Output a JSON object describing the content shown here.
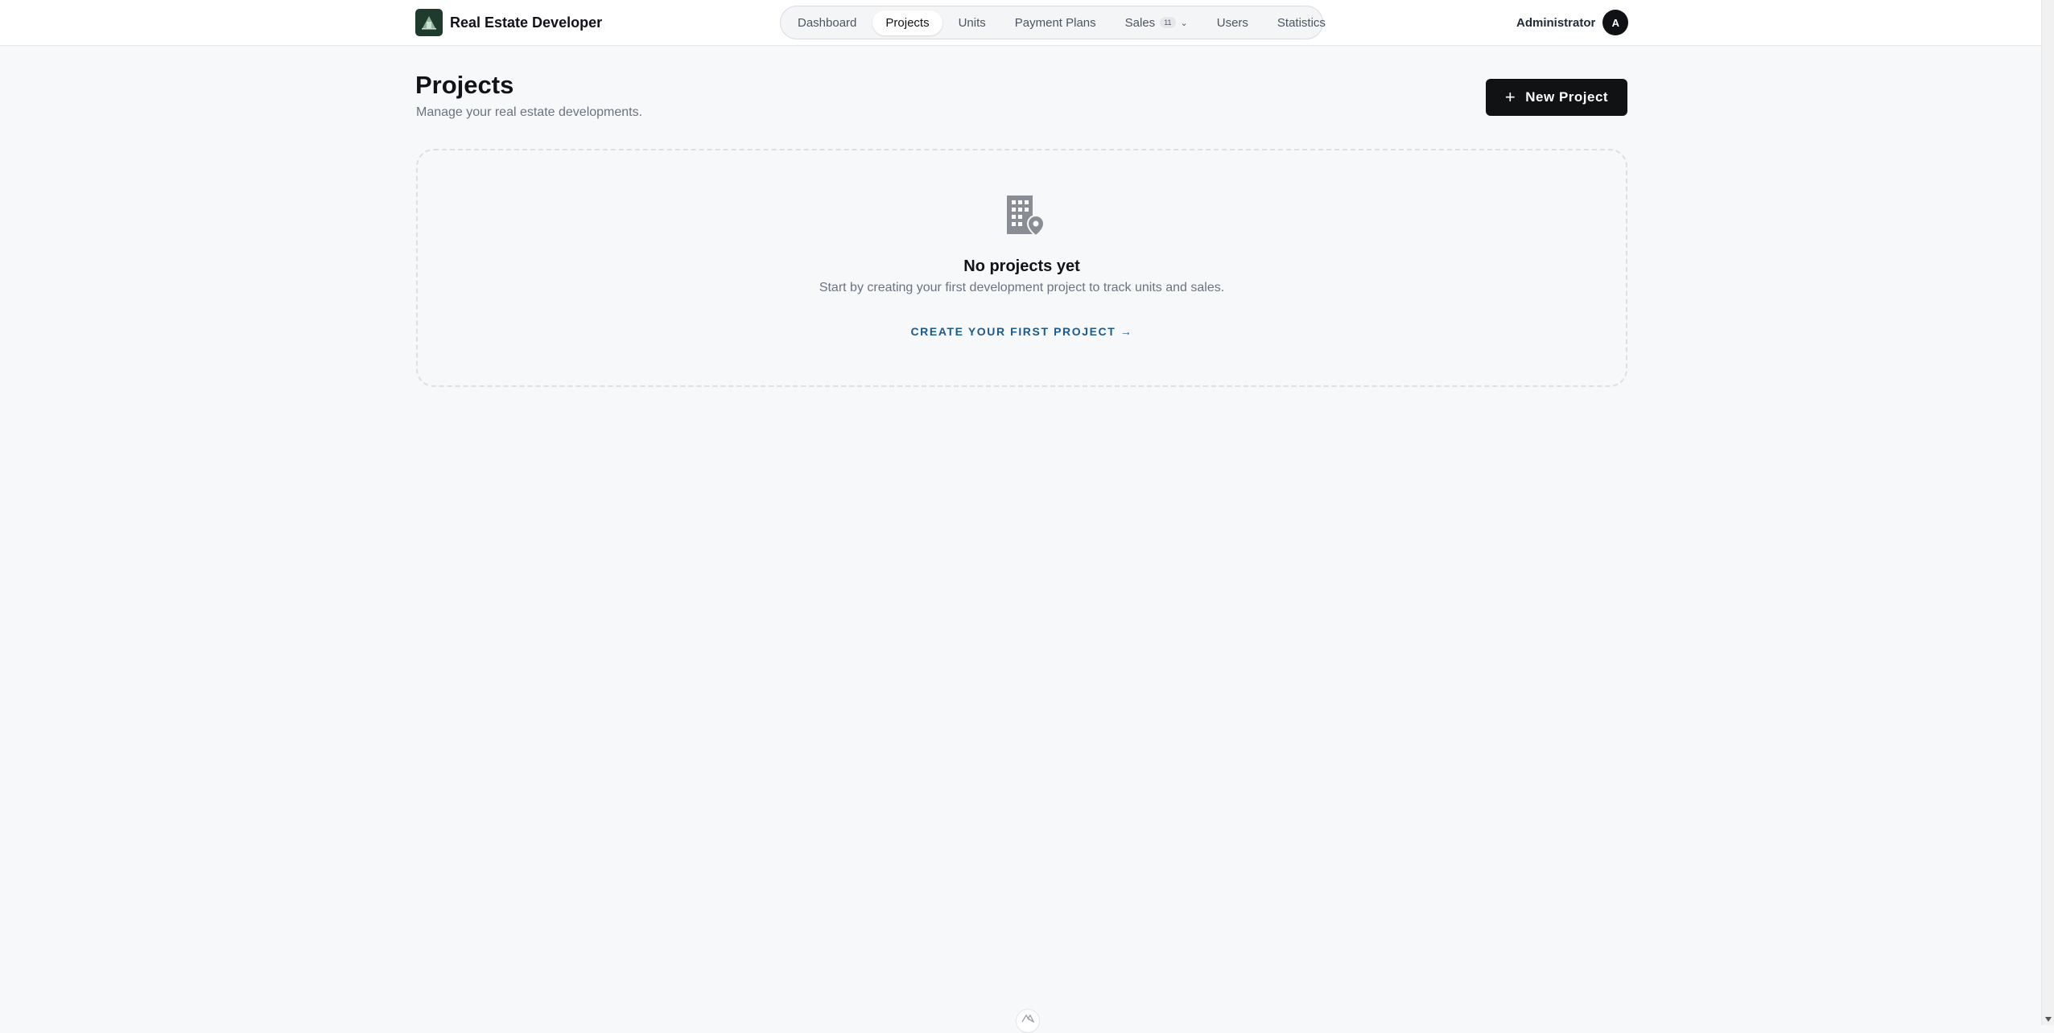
{
  "header": {
    "brand_name": "Real Estate Developer",
    "brand_color": "#1f3b2d",
    "nav": [
      {
        "label": "Dashboard"
      },
      {
        "label": "Projects",
        "active": true
      },
      {
        "label": "Units"
      },
      {
        "label": "Payment Plans"
      },
      {
        "label": "Sales",
        "badge": "11"
      },
      {
        "label": "Users"
      },
      {
        "label": "Statistics"
      }
    ],
    "user_name": "Administrator",
    "avatar_initial": "A"
  },
  "page": {
    "title": "Projects",
    "subtitle": "Manage your real estate developments.",
    "new_button_label": "New Project"
  },
  "empty_state": {
    "icon": "building-pin-icon",
    "title": "No projects yet",
    "text": "Start by creating your first development project to track units and sales.",
    "link_label": "CREATE YOUR FIRST PROJECT →"
  },
  "colors": {
    "accent": "#111214",
    "link": "#1d5a8c",
    "background": "#f7f8fa"
  }
}
